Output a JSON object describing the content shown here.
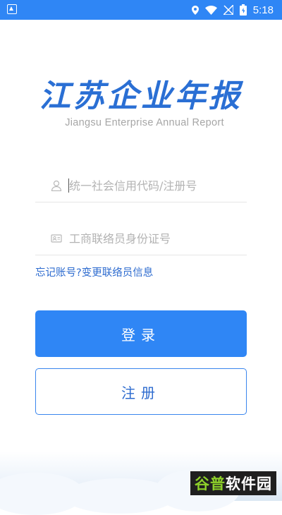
{
  "status_bar": {
    "time": "5:18",
    "icons": [
      "app-icon",
      "location-icon",
      "wifi-icon",
      "no-sim-icon",
      "battery-icon"
    ]
  },
  "logo": {
    "title": "江苏企业年报",
    "subtitle": "Jiangsu Enterprise Annual Report"
  },
  "form": {
    "credit_code_placeholder": "统一社会信用代码/注册号",
    "credit_code_value": "",
    "id_number_placeholder": "工商联络员身份证号",
    "id_number_value": "",
    "forgot_account": "忘记账号?",
    "change_contact": "变更联络员信息"
  },
  "buttons": {
    "login": "登录",
    "register": "注册"
  },
  "watermark": {
    "part1": "谷普",
    "part2": "软件园"
  },
  "colors": {
    "accent": "#2f86f5",
    "link": "#2d6bcf",
    "placeholder": "#b3b3b3",
    "subtitle": "#a6a6a6"
  }
}
